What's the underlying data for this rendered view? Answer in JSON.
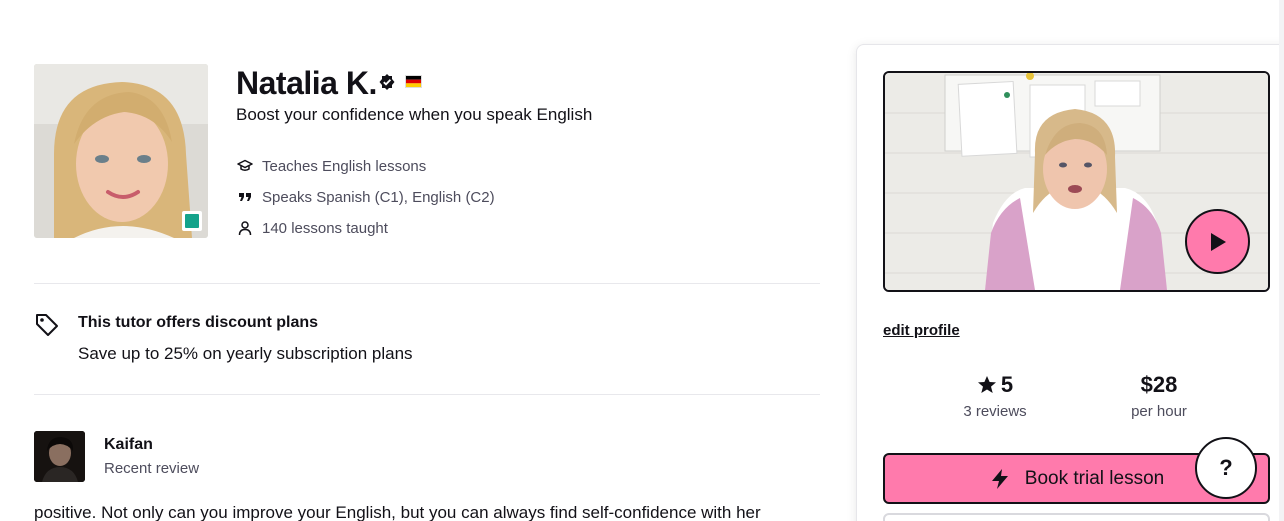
{
  "tutor": {
    "name": "Natalia K.",
    "headline": "Boost your confidence when you speak English",
    "facts": [
      {
        "icon": "graduation-cap-icon",
        "text": "Teaches English lessons"
      },
      {
        "icon": "quote-icon",
        "text": "Speaks Spanish (C1), English (C2)"
      },
      {
        "icon": "person-icon",
        "text": "140 lessons taught"
      }
    ],
    "status_color": "#14a38b"
  },
  "discount": {
    "title": "This tutor offers discount plans",
    "description": "Save up to 25% on yearly subscription plans"
  },
  "review": {
    "reviewer_name": "Kaifan",
    "tag": "Recent review",
    "text": "positive. Not only can you improve your English, but you can always find self-confidence with her"
  },
  "sidebar": {
    "edit_profile": "edit profile",
    "rating_value": "5",
    "rating_label": "3 reviews",
    "price_value": "$28",
    "price_label": "per hour",
    "book_button": "Book trial lesson",
    "help_label": "?"
  },
  "colors": {
    "accent_pink": "#ff7aac",
    "text_dark": "#121117",
    "text_muted": "#4d4c5c"
  }
}
